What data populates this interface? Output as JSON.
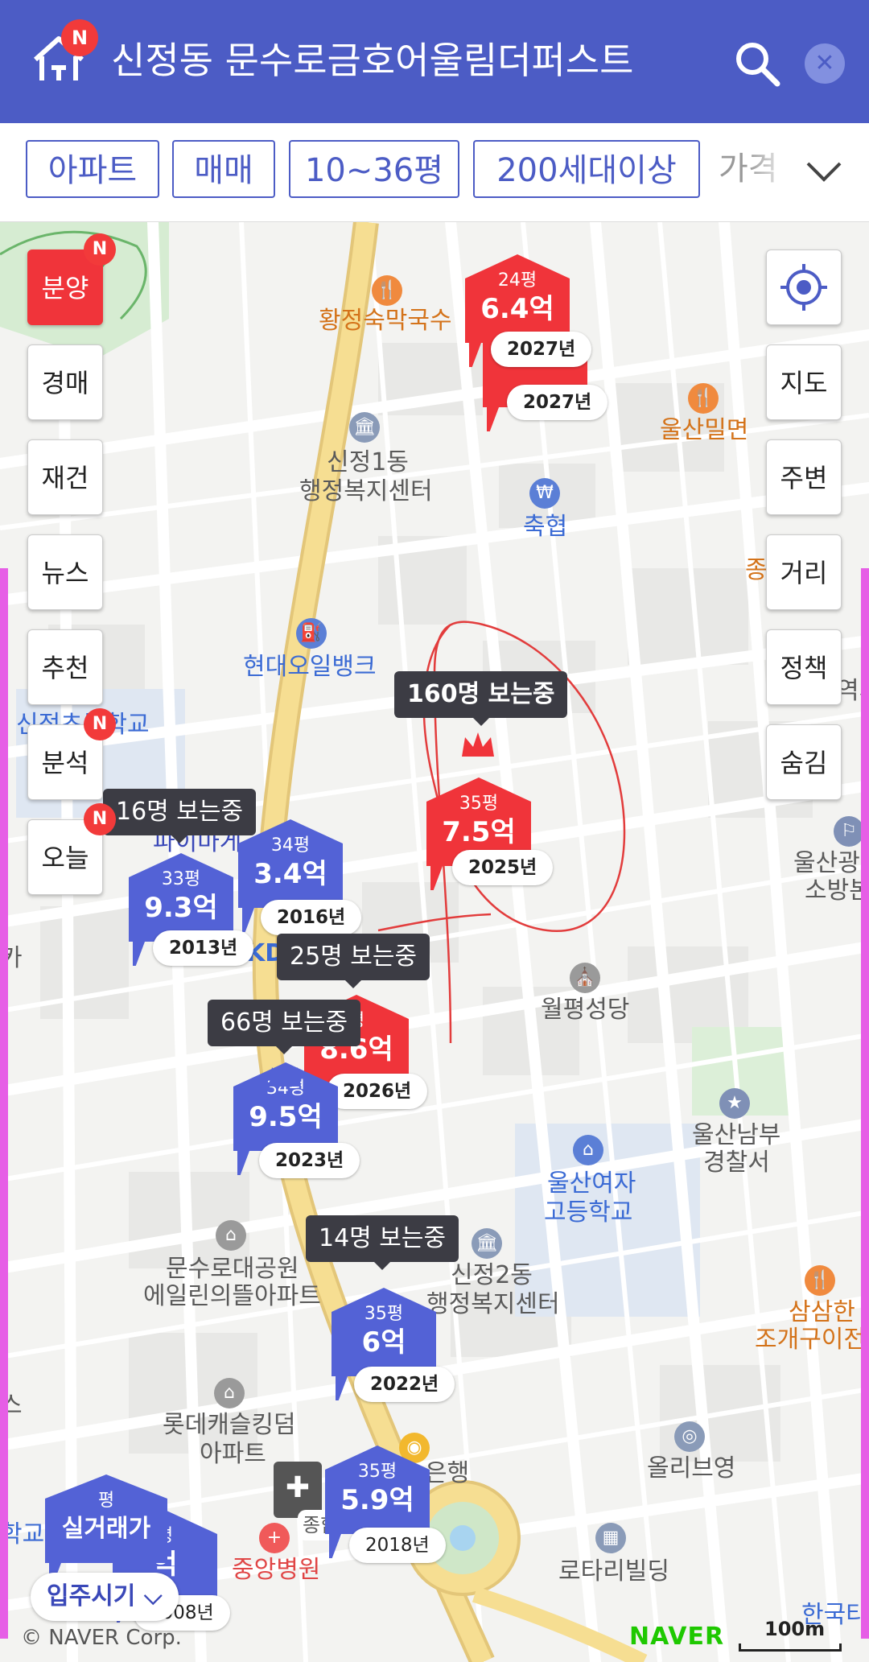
{
  "header": {
    "title": "신정동 문수로금호어울림더퍼스트",
    "logo_text": "N",
    "badge_text": "N",
    "colors": {
      "bar": "#4c5cc5",
      "badge": "#f23a3a"
    }
  },
  "filters": {
    "chips": [
      "아파트",
      "매매",
      "10~36평",
      "200세대이상"
    ],
    "more": "가격"
  },
  "left_buttons": [
    {
      "label": "분양",
      "badge": "N"
    },
    {
      "label": "경매",
      "badge": ""
    },
    {
      "label": "재건",
      "badge": ""
    },
    {
      "label": "뉴스",
      "badge": ""
    },
    {
      "label": "추천",
      "badge": ""
    },
    {
      "label": "분석",
      "badge": "N"
    },
    {
      "label": "오늘",
      "badge": "N"
    }
  ],
  "right_buttons": [
    "지도",
    "주변",
    "거리",
    "정책",
    "숨김"
  ],
  "places": {
    "hwangjeong": "황정숙막국수",
    "ulsan_noodle": "울산밀면",
    "sinjeong1": "신정1동",
    "sinjeong1b": "행정복지센터",
    "chukhyup": "축협",
    "hyundai_oil": "현대오일뱅크",
    "sinjeongcho": "신정초등학교",
    "wolpyeong": "월평성당",
    "ulsan_namu1": "울산남부",
    "ulsan_namu2": "경찰서",
    "ulsan_girls1": "울산여자",
    "ulsan_girls2": "고등학교",
    "munsu_park1": "문수로대공원",
    "munsu_park2": "에일린의뜰아파트",
    "sinjeong2": "신정2동",
    "sinjeong2b": "행정복지센터",
    "lotte1": "롯데캐슬킹덤",
    "lotte2": "아파트",
    "samsam1": "삼삼한",
    "samsam2": "조개구이전",
    "olive": "올리브영",
    "rotary": "로타리빌딩",
    "joongang": "중앙병원",
    "bank": "은행",
    "hanguk": "한국타",
    "fire1": "울산광역",
    "fire2": "소방본",
    "jong": "종",
    "jonghap": "종합",
    "ka": "카",
    "hak": "학교",
    "yeok": "역시",
    "seu": "스"
  },
  "markers": [
    {
      "size": "24평",
      "price": "6.4억",
      "year": "2027년",
      "type": "presale"
    },
    {
      "size": "",
      "price": "",
      "year": "2027년",
      "type": "presale"
    },
    {
      "size": "35평",
      "price": "7.5억",
      "year": "2025년",
      "type": "presale"
    },
    {
      "size": "33평",
      "price": "9.3억",
      "year": "2013년",
      "type": "sale"
    },
    {
      "size": "34평",
      "price": "3.4억",
      "year": "2016년",
      "type": "sale"
    },
    {
      "size": "평",
      "price": "8.6억",
      "year": "2026년",
      "type": "presale"
    },
    {
      "size": "34평",
      "price": "9.5억",
      "year": "2023년",
      "type": "sale"
    },
    {
      "size": "35평",
      "price": "6억",
      "year": "2022년",
      "type": "sale"
    },
    {
      "size": "35평",
      "price": "5.9억",
      "year": "2018년",
      "type": "sale"
    },
    {
      "size": "평",
      "price": "실거래가",
      "year": "",
      "type": "sale"
    },
    {
      "size": "평",
      "price": "억",
      "year": "2008년",
      "type": "sale"
    }
  ],
  "viewers": [
    "160명 보는중",
    "16명 보는중",
    "25명 보는중",
    "66명 보는중",
    "14명 보는중"
  ],
  "labels": {
    "pahimage": "파이마게",
    "kd": "KD"
  },
  "footer": {
    "copyright": "© NAVER Corp.",
    "brand": "NAVER",
    "scale": "100m",
    "movein": "입주시기"
  }
}
